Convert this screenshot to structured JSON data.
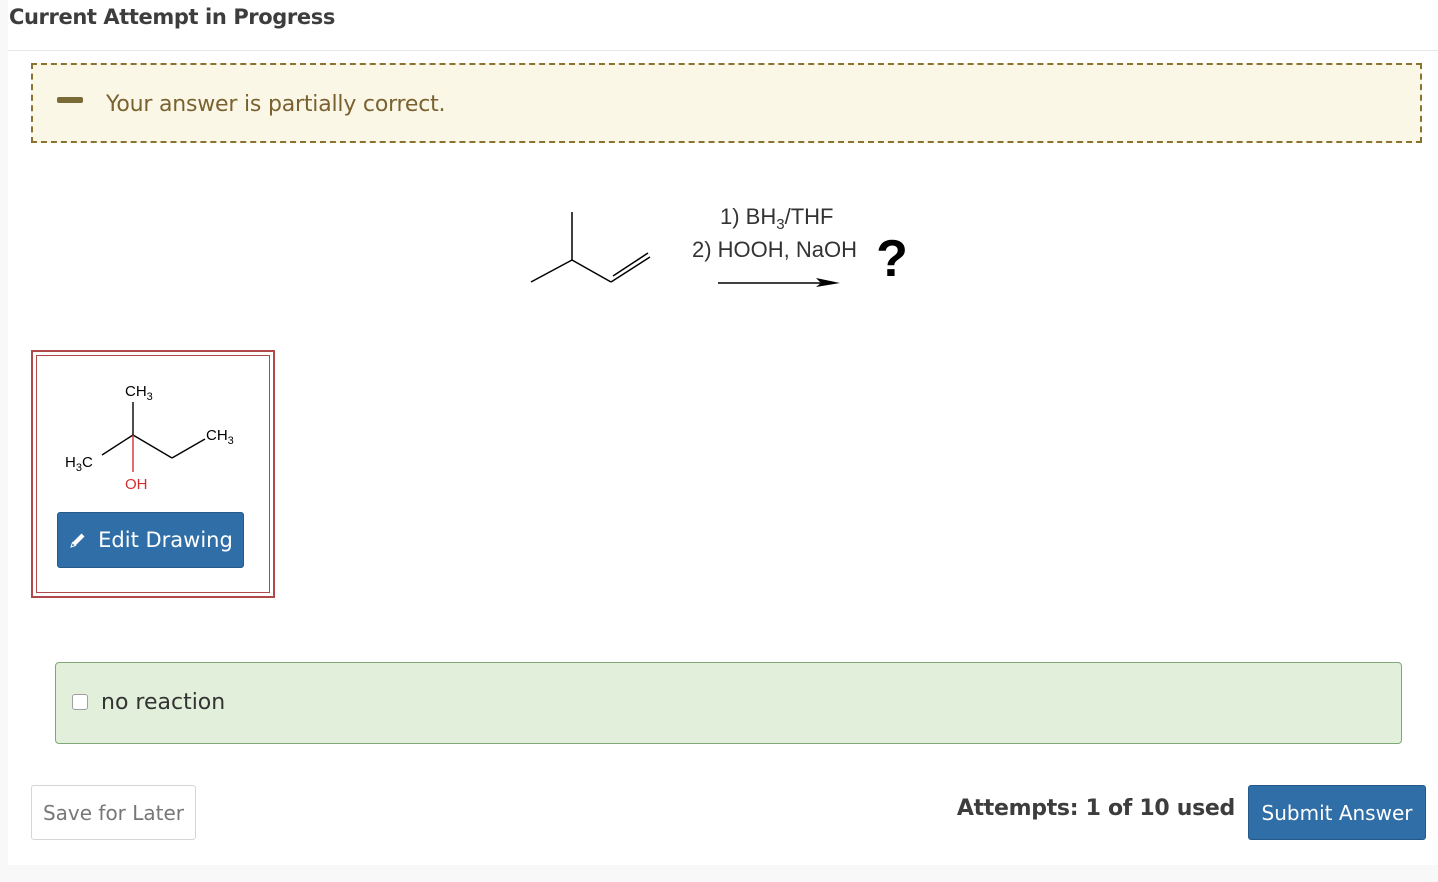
{
  "header": {
    "title": "Current Attempt in Progress"
  },
  "feedback": {
    "message": "Your answer is partially correct."
  },
  "reaction": {
    "step1_main": "1) BH",
    "step1_sub": "3",
    "step1_rest": "/THF",
    "step2": "2) HOOH, NaOH",
    "product_marker": "?"
  },
  "answer": {
    "atoms": {
      "ch3_top": "CH",
      "ch3_top_sub": "3",
      "ch3_right": "CH",
      "ch3_right_sub": "3",
      "h3c_left_h": "H",
      "h3c_left_sub": "3",
      "h3c_left_c": "C",
      "oh": "OH"
    },
    "edit_label": "Edit Drawing"
  },
  "options": {
    "no_reaction_label": "no reaction"
  },
  "footer": {
    "save_label": "Save for Later",
    "attempts_text": "Attempts: 1 of 10 used",
    "submit_label": "Submit Answer"
  },
  "colors": {
    "primary_button": "#2f6ea6",
    "feedback_border": "#8a7330",
    "feedback_bg": "#fbf7e7",
    "answer_border": "#b04a4a",
    "option_bg": "#e2efdb",
    "oxygen_bond": "#d32f2f"
  },
  "icons": {
    "pencil": "pencil-icon",
    "partial": "minus-icon",
    "arrow": "reaction-arrow-icon"
  }
}
